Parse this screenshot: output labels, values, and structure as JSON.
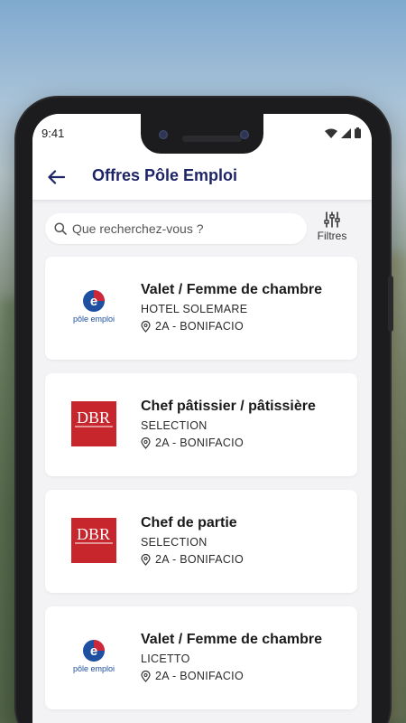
{
  "status_bar": {
    "time": "9:41"
  },
  "app_bar": {
    "title": "Offres Pôle Emploi"
  },
  "search": {
    "placeholder": "Que recherchez-vous ?"
  },
  "filters": {
    "label": "Filtres"
  },
  "offers": [
    {
      "title": "Valet / Femme de chambre",
      "company": "HOTEL SOLEMARE",
      "location": "2A - BONIFACIO",
      "logo": "pole-emploi-logo",
      "logo_text": "pôle emploi"
    },
    {
      "title": "Chef pâtissier / pâtissière",
      "company": "SELECTION",
      "location": "2A - BONIFACIO",
      "logo": "dbr-logo",
      "logo_text": "DBR"
    },
    {
      "title": "Chef de partie",
      "company": "SELECTION",
      "location": "2A - BONIFACIO",
      "logo": "dbr-logo",
      "logo_text": "DBR"
    },
    {
      "title": "Valet / Femme de chambre",
      "company": "LICETTO",
      "location": "2A - BONIFACIO",
      "logo": "pole-emploi-logo",
      "logo_text": "pôle emploi"
    }
  ],
  "colors": {
    "accent": "#1f2466",
    "pole_emploi_blue": "#1f4fa0",
    "pole_emploi_red": "#e0222e",
    "dbr_red": "#c7262d"
  }
}
